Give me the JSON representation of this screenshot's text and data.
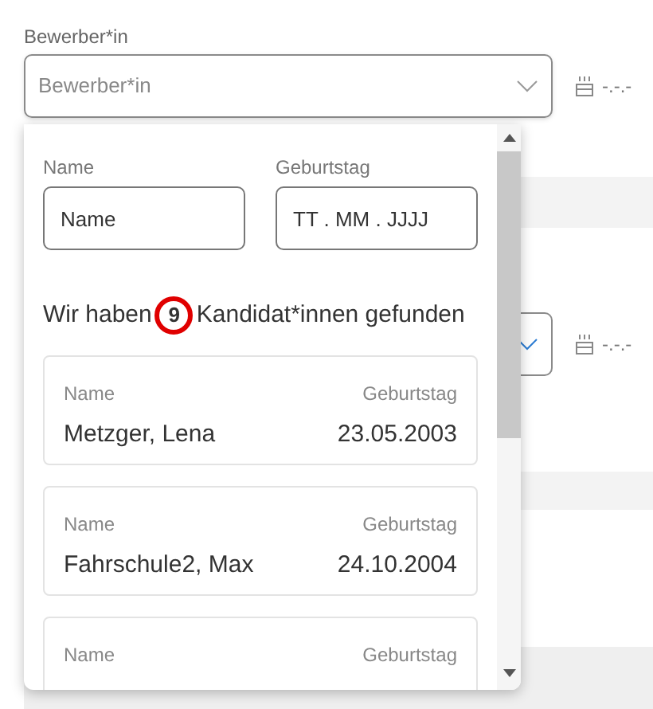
{
  "field": {
    "label": "Bewerber*in",
    "placeholder": "Bewerber*in",
    "birthday": "-.-.-"
  },
  "second_field": {
    "birthday": "-.-.-"
  },
  "dropdown": {
    "filters": [
      {
        "label": "Name",
        "placeholder": "Name"
      },
      {
        "label": "Geburtstag",
        "placeholder": "TT . MM . JJJJ"
      }
    ],
    "result": {
      "before": "Wir haben",
      "count": "9",
      "after": "Kandidat*innen gefunden",
      "circled": true
    },
    "candidates": [
      {
        "name_label": "Name",
        "name": "Metzger, Lena",
        "birthday_label": "Geburtstag",
        "birthday": "23.05.2003"
      },
      {
        "name_label": "Name",
        "name": "Fahrschule2, Max",
        "birthday_label": "Geburtstag",
        "birthday": "24.10.2004"
      },
      {
        "name_label": "Name",
        "birthday_label": "Geburtstag"
      }
    ]
  }
}
